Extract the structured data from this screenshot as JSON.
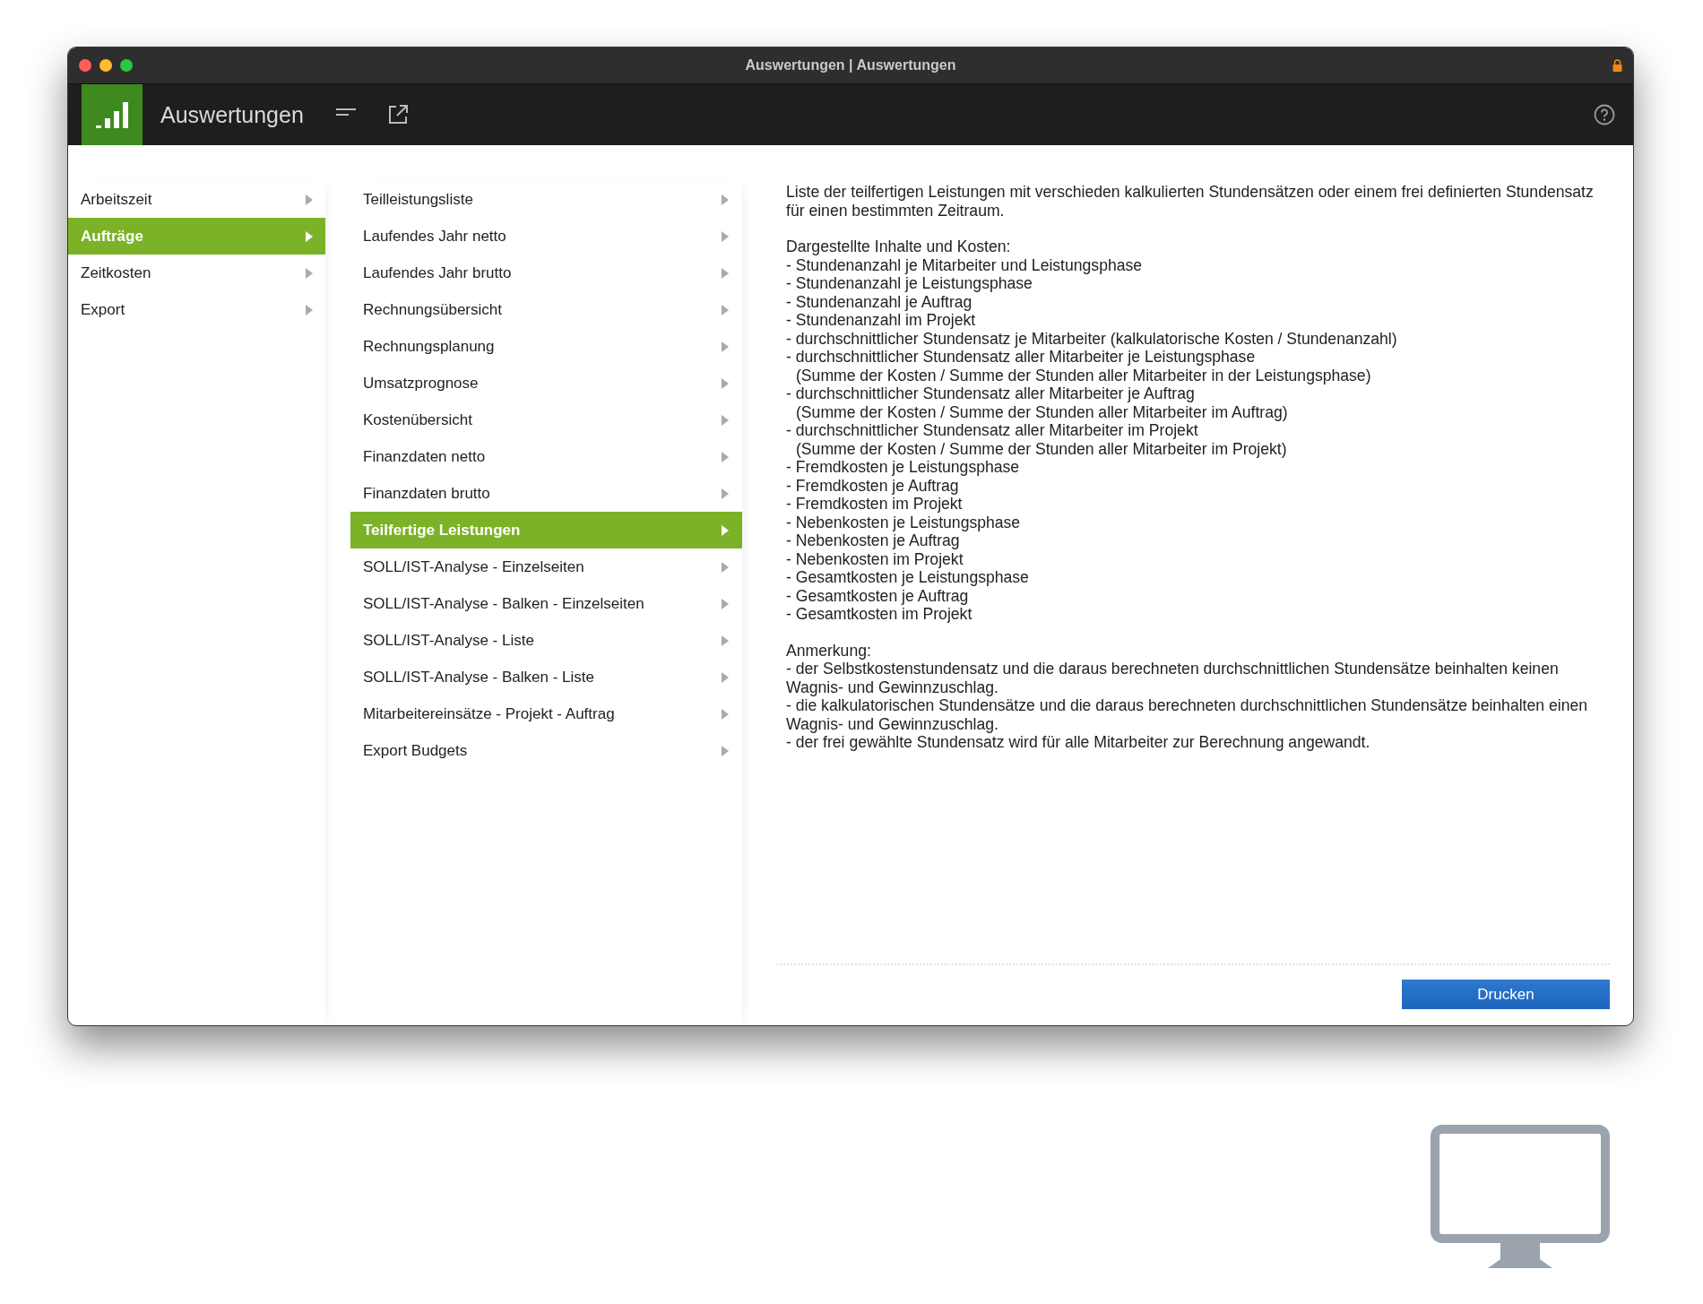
{
  "window": {
    "title": "Auswertungen | Auswertungen"
  },
  "header": {
    "title": "Auswertungen"
  },
  "categories": [
    {
      "label": "Arbeitszeit",
      "selected": false
    },
    {
      "label": "Aufträge",
      "selected": true
    },
    {
      "label": "Zeitkosten",
      "selected": false
    },
    {
      "label": "Export",
      "selected": false
    }
  ],
  "reports": [
    {
      "label": "Teilleistungsliste",
      "selected": false
    },
    {
      "label": "Laufendes Jahr netto",
      "selected": false
    },
    {
      "label": "Laufendes Jahr brutto",
      "selected": false
    },
    {
      "label": "Rechnungsübersicht",
      "selected": false
    },
    {
      "label": "Rechnungsplanung",
      "selected": false
    },
    {
      "label": "Umsatzprognose",
      "selected": false
    },
    {
      "label": "Kostenübersicht",
      "selected": false
    },
    {
      "label": "Finanzdaten netto",
      "selected": false
    },
    {
      "label": "Finanzdaten brutto",
      "selected": false
    },
    {
      "label": "Teilfertige Leistungen",
      "selected": true
    },
    {
      "label": "SOLL/IST-Analyse - Einzelseiten",
      "selected": false
    },
    {
      "label": "SOLL/IST-Analyse - Balken - Einzelseiten",
      "selected": false
    },
    {
      "label": "SOLL/IST-Analyse - Liste",
      "selected": false
    },
    {
      "label": "SOLL/IST-Analyse - Balken - Liste",
      "selected": false
    },
    {
      "label": "Mitarbeitereinsätze - Projekt - Auftrag",
      "selected": false
    },
    {
      "label": "Export Budgets",
      "selected": false
    }
  ],
  "description": [
    [
      {
        "text": "Liste der teilfertigen Leistungen mit verschieden kalkulierten Stundensätzen oder einem frei definierten Stundensatz für einen bestimmten Zeitraum.",
        "indent": false
      }
    ],
    [
      {
        "text": "Dargestellte Inhalte und Kosten:",
        "indent": false
      },
      {
        "text": "- Stundenanzahl je Mitarbeiter und Leistungsphase",
        "indent": false
      },
      {
        "text": "- Stundenanzahl je Leistungsphase",
        "indent": false
      },
      {
        "text": "- Stundenanzahl je Auftrag",
        "indent": false
      },
      {
        "text": "- Stundenanzahl im Projekt",
        "indent": false
      },
      {
        "text": "- durchschnittlicher Stundensatz je Mitarbeiter (kalkulatorische Kosten / Stundenanzahl)",
        "indent": false
      },
      {
        "text": "- durchschnittlicher Stundensatz aller Mitarbeiter je Leistungsphase",
        "indent": false
      },
      {
        "text": "(Summe der Kosten / Summe der Stunden aller Mitarbeiter in der Leistungsphase)",
        "indent": true
      },
      {
        "text": "- durchschnittlicher Stundensatz aller Mitarbeiter je Auftrag",
        "indent": false
      },
      {
        "text": "(Summe der Kosten / Summe der Stunden aller Mitarbeiter im Auftrag)",
        "indent": true
      },
      {
        "text": "- durchschnittlicher Stundensatz aller Mitarbeiter im Projekt",
        "indent": false
      },
      {
        "text": "(Summe der Kosten / Summe der Stunden aller Mitarbeiter im Projekt)",
        "indent": true
      },
      {
        "text": "- Fremdkosten je Leistungsphase",
        "indent": false
      },
      {
        "text": "- Fremdkosten je Auftrag",
        "indent": false
      },
      {
        "text": "- Fremdkosten im Projekt",
        "indent": false
      },
      {
        "text": "- Nebenkosten je Leistungsphase",
        "indent": false
      },
      {
        "text": "- Nebenkosten je Auftrag",
        "indent": false
      },
      {
        "text": "- Nebenkosten im Projekt",
        "indent": false
      },
      {
        "text": "- Gesamtkosten je Leistungsphase",
        "indent": false
      },
      {
        "text": "- Gesamtkosten je Auftrag",
        "indent": false
      },
      {
        "text": "- Gesamtkosten im Projekt",
        "indent": false
      }
    ],
    [
      {
        "text": "Anmerkung:",
        "indent": false
      },
      {
        "text": "- der Selbstkostenstundensatz und die daraus berechneten durchschnittlichen Stundensätze beinhalten keinen Wagnis- und Gewinnzuschlag.",
        "indent": false
      },
      {
        "text": "- die kalkulatorischen Stundensätze und die daraus berechneten durchschnittlichen Stundensätze beinhalten einen Wagnis- und Gewinnzuschlag.",
        "indent": false
      },
      {
        "text": "- der frei gewählte Stundensatz wird für alle Mitarbeiter zur Berechnung angewandt.",
        "indent": false
      }
    ]
  ],
  "print_button": {
    "label": "Drucken"
  }
}
